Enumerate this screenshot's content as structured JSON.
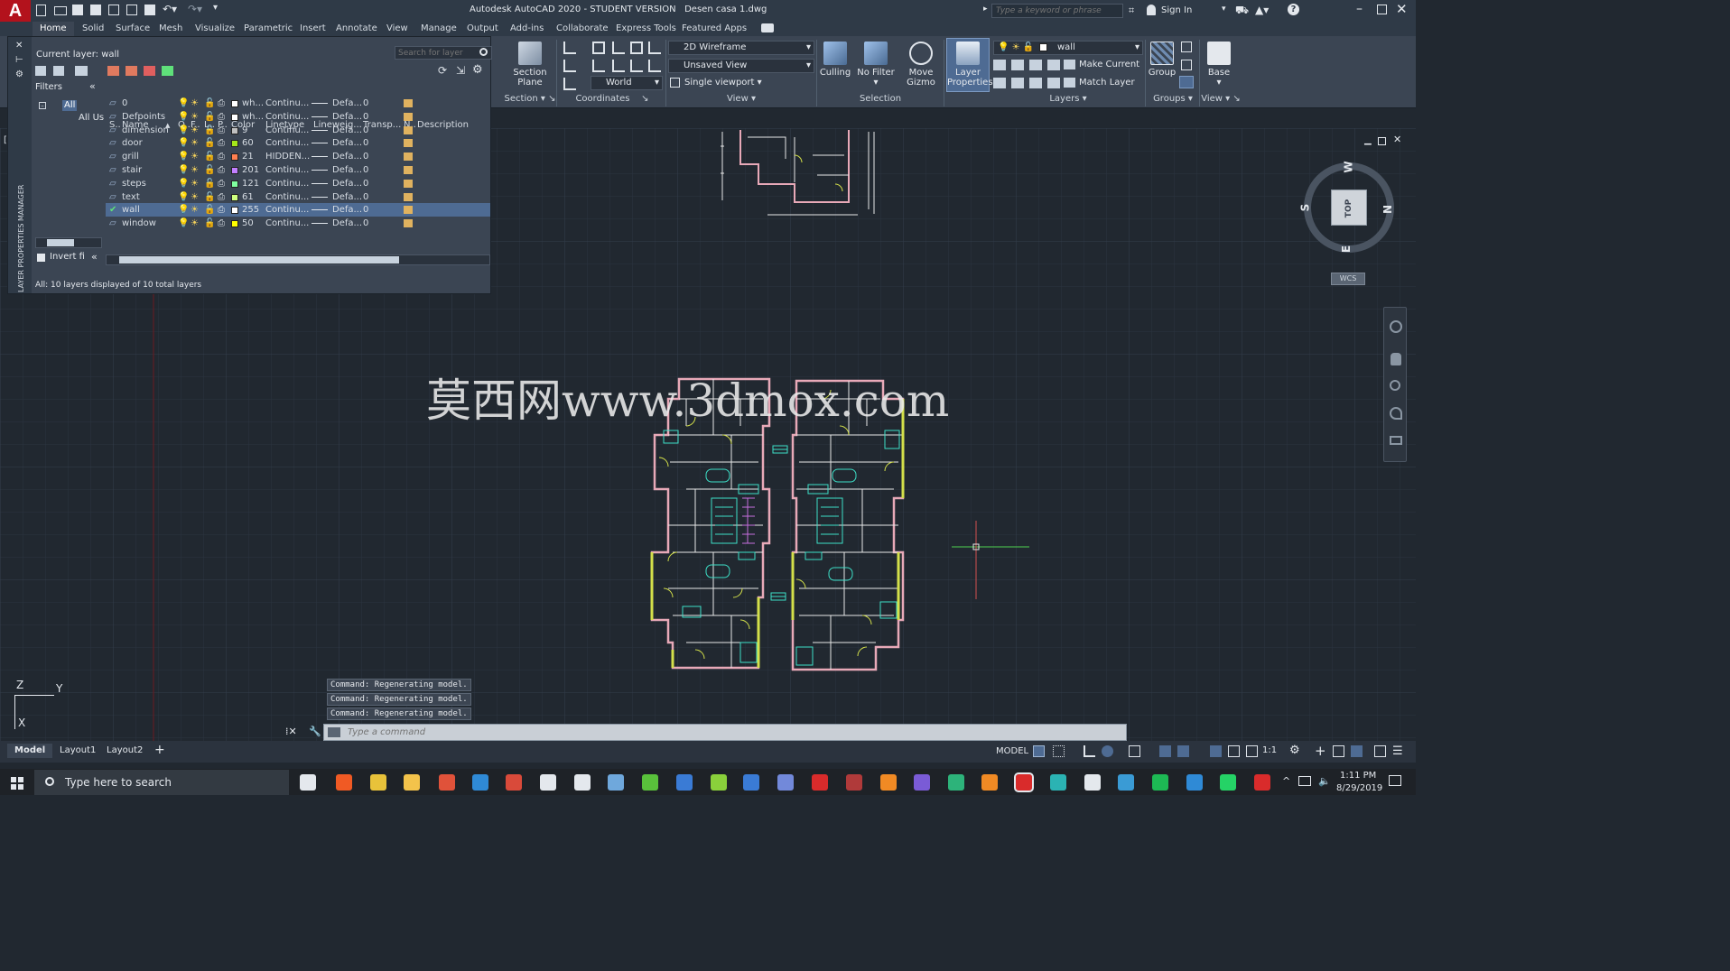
{
  "app": {
    "title": "Autodesk AutoCAD 2020 - STUDENT VERSION",
    "document": "Desen casa 1.dwg",
    "search_placeholder": "Type a keyword or phrase",
    "sign_in": "Sign In"
  },
  "ribbon_tabs": [
    "Home",
    "Solid",
    "Surface",
    "Mesh",
    "Visualize",
    "Parametric",
    "Insert",
    "Annotate",
    "View",
    "Manage",
    "Output",
    "Add-ins",
    "Collaborate",
    "Express Tools",
    "Featured Apps"
  ],
  "ribbon": {
    "section_plane": "Section Plane",
    "section_panel": "Section",
    "coordinates_panel": "Coordinates",
    "world": "World",
    "visual_style": "2D Wireframe",
    "named_view": "Unsaved View",
    "viewport": "Single viewport",
    "view_panel": "View",
    "culling": "Culling",
    "no_filter": "No Filter",
    "move_gizmo": "Move Gizmo",
    "selection_panel": "Selection",
    "layer_properties": "Layer Properties",
    "current_layer": "wall",
    "make_current": "Make Current",
    "match_layer": "Match Layer",
    "layers_panel": "Layers",
    "group": "Group",
    "groups_panel": "Groups",
    "base": "Base",
    "view_panel2": "View"
  },
  "layer_manager": {
    "current_layer_label": "Current layer: wall",
    "search_placeholder": "Search for layer",
    "filters_label": "Filters",
    "tree_all": "All",
    "tree_all_used": "All Us",
    "invert_filter": "Invert fi",
    "side_title": "LAYER PROPERTIES MANAGER",
    "status": "All: 10 layers displayed of 10 total layers",
    "columns": [
      "S..",
      "Name",
      "O..",
      "F..",
      "L..",
      "P..",
      "Color",
      "Linetype",
      "Lineweig...",
      "Transp...",
      "N..",
      "Description"
    ],
    "layers": [
      {
        "name": "0",
        "color": "wh...",
        "swatch": "#ffffff",
        "linetype": "Continu...",
        "lineweight": "Defa...",
        "transparency": "0"
      },
      {
        "name": "Defpoints",
        "color": "wh...",
        "swatch": "#ffffff",
        "linetype": "Continu...",
        "lineweight": "Defa...",
        "transparency": "0"
      },
      {
        "name": "dimension",
        "color": "9",
        "swatch": "#c0c0c0",
        "linetype": "Continu...",
        "lineweight": "Defa...",
        "transparency": "0"
      },
      {
        "name": "door",
        "color": "60",
        "swatch": "#a5e619",
        "linetype": "Continu...",
        "lineweight": "Defa...",
        "transparency": "0"
      },
      {
        "name": "grill",
        "color": "21",
        "swatch": "#ff7f50",
        "linetype": "HIDDEN...",
        "lineweight": "Defa...",
        "transparency": "0"
      },
      {
        "name": "stair",
        "color": "201",
        "swatch": "#c27fff",
        "linetype": "Continu...",
        "lineweight": "Defa...",
        "transparency": "0"
      },
      {
        "name": "steps",
        "color": "121",
        "swatch": "#7fff9f",
        "linetype": "Continu...",
        "lineweight": "Defa...",
        "transparency": "0"
      },
      {
        "name": "text",
        "color": "61",
        "swatch": "#cfff7f",
        "linetype": "Continu...",
        "lineweight": "Defa...",
        "transparency": "0"
      },
      {
        "name": "wall",
        "color": "255",
        "swatch": "#ffffff",
        "linetype": "Continu...",
        "lineweight": "Defa...",
        "transparency": "0",
        "current": true
      },
      {
        "name": "window",
        "color": "50",
        "swatch": "#ffff00",
        "linetype": "Continu...",
        "lineweight": "Defa...",
        "transparency": "0"
      }
    ]
  },
  "viewcube": {
    "top": "TOP",
    "north": "N",
    "south": "S",
    "east": "E",
    "west": "W",
    "wcs": "WCS"
  },
  "watermark": "莫西网www.3dmox.com",
  "ucs": {
    "x": "X",
    "y": "Y",
    "z": "Z"
  },
  "command_history": [
    "Command:  Regenerating model.",
    "Command:  Regenerating model.",
    "Command:  Regenerating model."
  ],
  "command_placeholder": "Type a command",
  "layout_tabs": [
    "Model",
    "Layout1",
    "Layout2"
  ],
  "status": {
    "model": "MODEL",
    "scale": "1:1"
  },
  "taskbar": {
    "search": "Type here to search",
    "time": "1:11 PM",
    "date": "8/29/2019"
  },
  "colors": {
    "accent": "#4e6b93",
    "wall": "#e8a9b8",
    "furniture": "#3de0c8",
    "door": "#d4e04a",
    "stair": "#c86fe0"
  }
}
